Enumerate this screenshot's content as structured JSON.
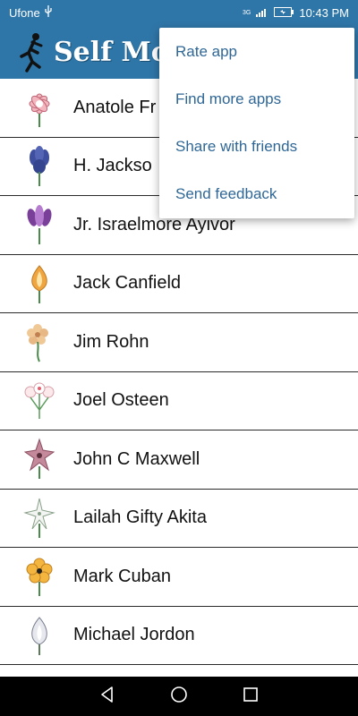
{
  "status_bar": {
    "carrier": "Ufone",
    "usb_icon": "usb-icon",
    "network": "3G",
    "time": "10:43 PM"
  },
  "app_bar": {
    "title": "Self Moti",
    "logo_icon": "runner-icon"
  },
  "list": {
    "items": [
      {
        "name": "Anatole Fr",
        "icon": "pink-flower-icon"
      },
      {
        "name": "H. Jackso",
        "icon": "blue-iris-icon"
      },
      {
        "name": "Jr. Israelmore Ayivor",
        "icon": "purple-iris-icon"
      },
      {
        "name": "Jack Canfield",
        "icon": "orange-bud-icon"
      },
      {
        "name": "Jim Rohn",
        "icon": "peach-flower-icon"
      },
      {
        "name": "Joel Osteen",
        "icon": "white-blossom-icon"
      },
      {
        "name": "John C Maxwell",
        "icon": "pink-star-flower-icon"
      },
      {
        "name": "Lailah Gifty Akita",
        "icon": "white-star-flower-icon"
      },
      {
        "name": "Mark Cuban",
        "icon": "yellow-flower-icon"
      },
      {
        "name": "Michael Jordon",
        "icon": "silver-bud-icon"
      }
    ]
  },
  "overflow_menu": {
    "items": [
      "Rate app",
      "Find more apps",
      "Share with friends",
      "Send feedback"
    ]
  },
  "nav_bar": {
    "back_icon": "back-icon",
    "home_icon": "home-icon",
    "recents_icon": "recents-icon"
  },
  "colors": {
    "app_bar": "#2f76a8",
    "menu_text": "#2f6796"
  }
}
